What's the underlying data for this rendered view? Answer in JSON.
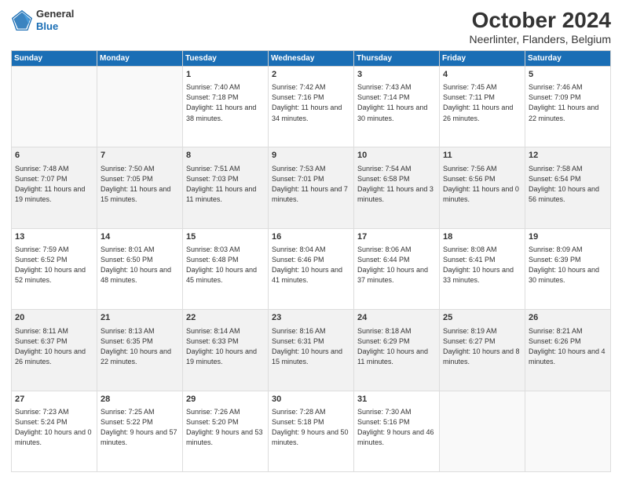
{
  "logo": {
    "line1": "General",
    "line2": "Blue"
  },
  "title": "October 2024",
  "subtitle": "Neerlinter, Flanders, Belgium",
  "weekdays": [
    "Sunday",
    "Monday",
    "Tuesday",
    "Wednesday",
    "Thursday",
    "Friday",
    "Saturday"
  ],
  "weeks": [
    [
      {
        "day": "",
        "sunrise": "",
        "sunset": "",
        "daylight": ""
      },
      {
        "day": "",
        "sunrise": "",
        "sunset": "",
        "daylight": ""
      },
      {
        "day": "1",
        "sunrise": "Sunrise: 7:40 AM",
        "sunset": "Sunset: 7:18 PM",
        "daylight": "Daylight: 11 hours and 38 minutes."
      },
      {
        "day": "2",
        "sunrise": "Sunrise: 7:42 AM",
        "sunset": "Sunset: 7:16 PM",
        "daylight": "Daylight: 11 hours and 34 minutes."
      },
      {
        "day": "3",
        "sunrise": "Sunrise: 7:43 AM",
        "sunset": "Sunset: 7:14 PM",
        "daylight": "Daylight: 11 hours and 30 minutes."
      },
      {
        "day": "4",
        "sunrise": "Sunrise: 7:45 AM",
        "sunset": "Sunset: 7:11 PM",
        "daylight": "Daylight: 11 hours and 26 minutes."
      },
      {
        "day": "5",
        "sunrise": "Sunrise: 7:46 AM",
        "sunset": "Sunset: 7:09 PM",
        "daylight": "Daylight: 11 hours and 22 minutes."
      }
    ],
    [
      {
        "day": "6",
        "sunrise": "Sunrise: 7:48 AM",
        "sunset": "Sunset: 7:07 PM",
        "daylight": "Daylight: 11 hours and 19 minutes."
      },
      {
        "day": "7",
        "sunrise": "Sunrise: 7:50 AM",
        "sunset": "Sunset: 7:05 PM",
        "daylight": "Daylight: 11 hours and 15 minutes."
      },
      {
        "day": "8",
        "sunrise": "Sunrise: 7:51 AM",
        "sunset": "Sunset: 7:03 PM",
        "daylight": "Daylight: 11 hours and 11 minutes."
      },
      {
        "day": "9",
        "sunrise": "Sunrise: 7:53 AM",
        "sunset": "Sunset: 7:01 PM",
        "daylight": "Daylight: 11 hours and 7 minutes."
      },
      {
        "day": "10",
        "sunrise": "Sunrise: 7:54 AM",
        "sunset": "Sunset: 6:58 PM",
        "daylight": "Daylight: 11 hours and 3 minutes."
      },
      {
        "day": "11",
        "sunrise": "Sunrise: 7:56 AM",
        "sunset": "Sunset: 6:56 PM",
        "daylight": "Daylight: 11 hours and 0 minutes."
      },
      {
        "day": "12",
        "sunrise": "Sunrise: 7:58 AM",
        "sunset": "Sunset: 6:54 PM",
        "daylight": "Daylight: 10 hours and 56 minutes."
      }
    ],
    [
      {
        "day": "13",
        "sunrise": "Sunrise: 7:59 AM",
        "sunset": "Sunset: 6:52 PM",
        "daylight": "Daylight: 10 hours and 52 minutes."
      },
      {
        "day": "14",
        "sunrise": "Sunrise: 8:01 AM",
        "sunset": "Sunset: 6:50 PM",
        "daylight": "Daylight: 10 hours and 48 minutes."
      },
      {
        "day": "15",
        "sunrise": "Sunrise: 8:03 AM",
        "sunset": "Sunset: 6:48 PM",
        "daylight": "Daylight: 10 hours and 45 minutes."
      },
      {
        "day": "16",
        "sunrise": "Sunrise: 8:04 AM",
        "sunset": "Sunset: 6:46 PM",
        "daylight": "Daylight: 10 hours and 41 minutes."
      },
      {
        "day": "17",
        "sunrise": "Sunrise: 8:06 AM",
        "sunset": "Sunset: 6:44 PM",
        "daylight": "Daylight: 10 hours and 37 minutes."
      },
      {
        "day": "18",
        "sunrise": "Sunrise: 8:08 AM",
        "sunset": "Sunset: 6:41 PM",
        "daylight": "Daylight: 10 hours and 33 minutes."
      },
      {
        "day": "19",
        "sunrise": "Sunrise: 8:09 AM",
        "sunset": "Sunset: 6:39 PM",
        "daylight": "Daylight: 10 hours and 30 minutes."
      }
    ],
    [
      {
        "day": "20",
        "sunrise": "Sunrise: 8:11 AM",
        "sunset": "Sunset: 6:37 PM",
        "daylight": "Daylight: 10 hours and 26 minutes."
      },
      {
        "day": "21",
        "sunrise": "Sunrise: 8:13 AM",
        "sunset": "Sunset: 6:35 PM",
        "daylight": "Daylight: 10 hours and 22 minutes."
      },
      {
        "day": "22",
        "sunrise": "Sunrise: 8:14 AM",
        "sunset": "Sunset: 6:33 PM",
        "daylight": "Daylight: 10 hours and 19 minutes."
      },
      {
        "day": "23",
        "sunrise": "Sunrise: 8:16 AM",
        "sunset": "Sunset: 6:31 PM",
        "daylight": "Daylight: 10 hours and 15 minutes."
      },
      {
        "day": "24",
        "sunrise": "Sunrise: 8:18 AM",
        "sunset": "Sunset: 6:29 PM",
        "daylight": "Daylight: 10 hours and 11 minutes."
      },
      {
        "day": "25",
        "sunrise": "Sunrise: 8:19 AM",
        "sunset": "Sunset: 6:27 PM",
        "daylight": "Daylight: 10 hours and 8 minutes."
      },
      {
        "day": "26",
        "sunrise": "Sunrise: 8:21 AM",
        "sunset": "Sunset: 6:26 PM",
        "daylight": "Daylight: 10 hours and 4 minutes."
      }
    ],
    [
      {
        "day": "27",
        "sunrise": "Sunrise: 7:23 AM",
        "sunset": "Sunset: 5:24 PM",
        "daylight": "Daylight: 10 hours and 0 minutes."
      },
      {
        "day": "28",
        "sunrise": "Sunrise: 7:25 AM",
        "sunset": "Sunset: 5:22 PM",
        "daylight": "Daylight: 9 hours and 57 minutes."
      },
      {
        "day": "29",
        "sunrise": "Sunrise: 7:26 AM",
        "sunset": "Sunset: 5:20 PM",
        "daylight": "Daylight: 9 hours and 53 minutes."
      },
      {
        "day": "30",
        "sunrise": "Sunrise: 7:28 AM",
        "sunset": "Sunset: 5:18 PM",
        "daylight": "Daylight: 9 hours and 50 minutes."
      },
      {
        "day": "31",
        "sunrise": "Sunrise: 7:30 AM",
        "sunset": "Sunset: 5:16 PM",
        "daylight": "Daylight: 9 hours and 46 minutes."
      },
      {
        "day": "",
        "sunrise": "",
        "sunset": "",
        "daylight": ""
      },
      {
        "day": "",
        "sunrise": "",
        "sunset": "",
        "daylight": ""
      }
    ]
  ]
}
